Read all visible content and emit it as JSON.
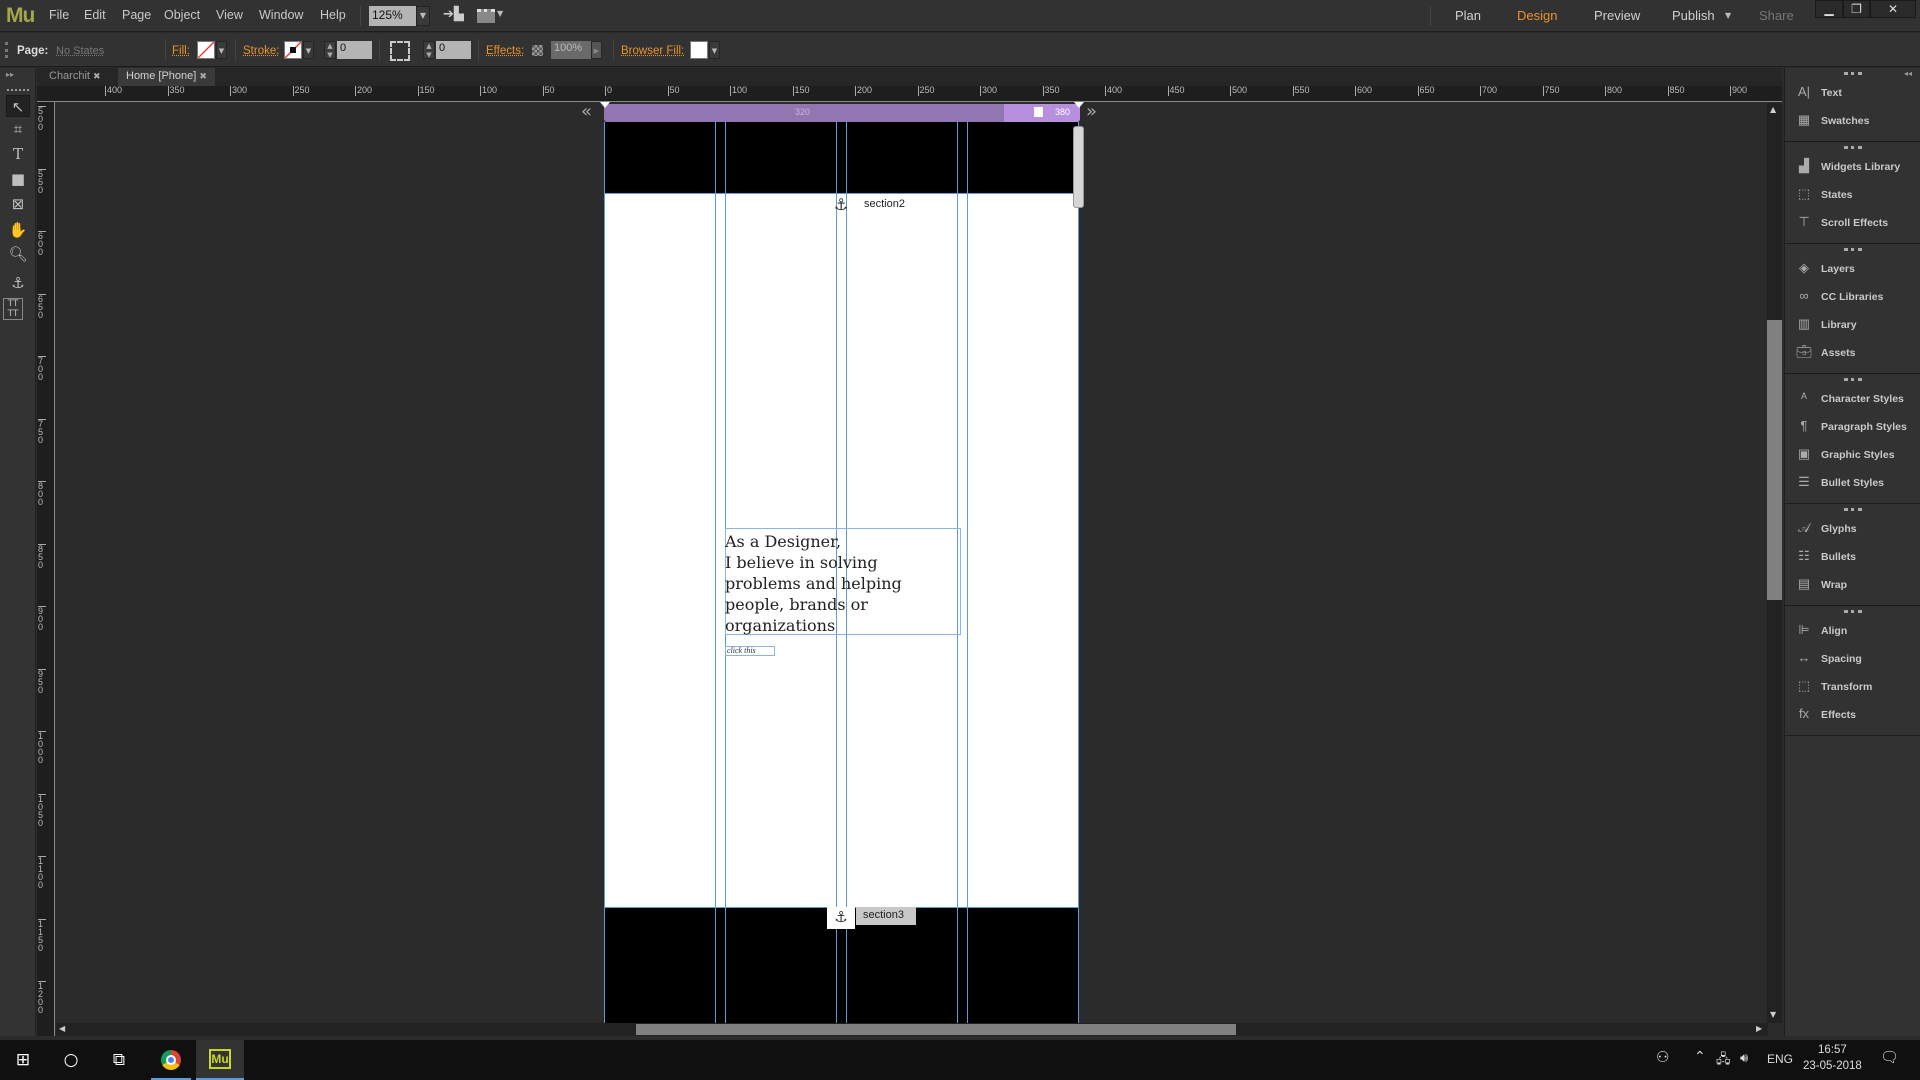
{
  "app": {
    "logo": "Mu",
    "menu": [
      "File",
      "Edit",
      "Page",
      "Object",
      "View",
      "Window",
      "Help"
    ],
    "zoom_level": "125%",
    "modes": {
      "plan": "Plan",
      "design": "Design",
      "preview": "Preview",
      "publish": "Publish",
      "share": "Share"
    },
    "active_mode": "Design",
    "accent_color": "#e8942c"
  },
  "control_bar": {
    "page_label": "Page:",
    "page_state": "No States",
    "fill_label": "Fill:",
    "stroke_label": "Stroke:",
    "stroke_width": "0",
    "corner_radius": "0",
    "effects_label": "Effects:",
    "opacity": "100%",
    "browser_fill_label": "Browser Fill:"
  },
  "tabs": [
    {
      "label": "Charchit",
      "active": false
    },
    {
      "label": "Home [Phone]",
      "active": true
    }
  ],
  "rulers": {
    "horizontal": [
      "400",
      "350",
      "300",
      "250",
      "200",
      "150",
      "100",
      "50",
      "0",
      "50",
      "100",
      "150",
      "200",
      "250",
      "300",
      "350",
      "400",
      "450",
      "500",
      "550",
      "600",
      "650",
      "700",
      "750",
      "800",
      "850",
      "900"
    ],
    "vertical": [
      "500",
      "550",
      "600",
      "650",
      "700",
      "750",
      "800",
      "850",
      "900",
      "950",
      "1000",
      "1050",
      "1100",
      "1150",
      "1200"
    ]
  },
  "breakpoints": {
    "primary": "320",
    "secondary": "380",
    "color": "#9276b2"
  },
  "page_content": {
    "anchor1": "section2",
    "anchor2": "section3",
    "heading_lines": [
      "As a Designer,",
      "I believe in solving",
      "problems and helping",
      "people, brands or",
      "organizations"
    ],
    "link_text": "click this"
  },
  "right_panel": {
    "groups": [
      [
        "Text",
        "Swatches"
      ],
      [
        "Widgets Library",
        "States",
        "Scroll Effects"
      ],
      [
        "Layers",
        "CC Libraries",
        "Library",
        "Assets"
      ],
      [
        "Character Styles",
        "Paragraph Styles",
        "Graphic Styles",
        "Bullet Styles"
      ],
      [
        "Glyphs",
        "Bullets",
        "Wrap"
      ],
      [
        "Align",
        "Spacing",
        "Transform",
        "Effects"
      ]
    ]
  },
  "taskbar": {
    "language": "ENG",
    "time": "16:57",
    "date": "23-05-2018"
  }
}
